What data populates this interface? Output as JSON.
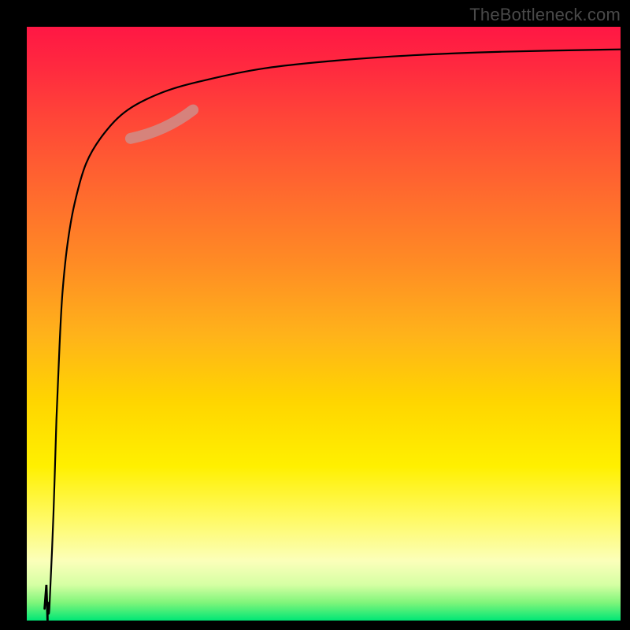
{
  "attribution": "TheBottleneck.com",
  "colors": {
    "frame": "#000000",
    "gradient_top": "#ff1744",
    "gradient_mid1": "#ff8c24",
    "gradient_mid2": "#fff000",
    "gradient_bottom": "#00e676",
    "curve": "#000000",
    "highlight": "#d08b85"
  },
  "chart_data": {
    "type": "line",
    "title": "",
    "xlabel": "",
    "ylabel": "",
    "xlim": [
      0,
      100
    ],
    "ylim": [
      0,
      100
    ],
    "curve_points_xy": [
      [
        3.5,
        0
      ],
      [
        3.6,
        3
      ],
      [
        3.8,
        2
      ],
      [
        4.5,
        18
      ],
      [
        5.0,
        34
      ],
      [
        5.5,
        46
      ],
      [
        6.0,
        55
      ],
      [
        6.8,
        63
      ],
      [
        8.0,
        70
      ],
      [
        10.0,
        77
      ],
      [
        13.0,
        82
      ],
      [
        17.0,
        86
      ],
      [
        23.0,
        89
      ],
      [
        30.0,
        91
      ],
      [
        40.0,
        93
      ],
      [
        52.0,
        94.3
      ],
      [
        65.0,
        95.2
      ],
      [
        80.0,
        95.8
      ],
      [
        100.0,
        96.2
      ]
    ],
    "spike_points_xy": [
      [
        3.5,
        0
      ],
      [
        3.3,
        6
      ],
      [
        3.0,
        2
      ]
    ],
    "highlight_segment_xy": [
      [
        17.5,
        81.2
      ],
      [
        28.0,
        86.0
      ]
    ],
    "annotations": []
  }
}
